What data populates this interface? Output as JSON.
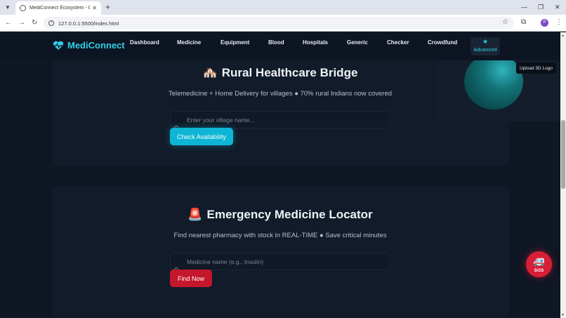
{
  "browser": {
    "tab_title": "MediConnect Ecosystem - Con",
    "tab_close": "✕",
    "new_tab": "+",
    "url": "127.0.0.1:5500/index.html",
    "window_controls": {
      "minimize": "—",
      "restore": "❐",
      "close": "✕"
    },
    "profile_initial": "P"
  },
  "navbar": {
    "brand": "MediConnect",
    "links": [
      "Dashboard",
      "Medicine",
      "Equipment",
      "Blood",
      "Hospitals",
      "Generic",
      "Checker",
      "Crowdfund"
    ],
    "advanced_label": "Advanced"
  },
  "upload_3d_logo": "Upload 3D Logo",
  "rural": {
    "emoji": "🏘️",
    "title": "Rural Healthcare Bridge",
    "subtitle": "Telemedicine + Home Delivery for villages ● 70% rural Indians now covered",
    "input_placeholder": "Enter your village name...",
    "button": "Check Availability"
  },
  "emergency": {
    "emoji": "🚨",
    "title": "Emergency Medicine Locator",
    "subtitle": "Find nearest pharmacy with stock in REAL-TIME ● Save critical minutes",
    "input_placeholder": "Medicine name (e.g., Insulin)",
    "button": "Find Now"
  },
  "sos": {
    "icon": "🚑",
    "label": "SOS"
  },
  "colors": {
    "accent": "#0fb5d4",
    "danger": "#c4162c",
    "background": "#0f1624"
  }
}
